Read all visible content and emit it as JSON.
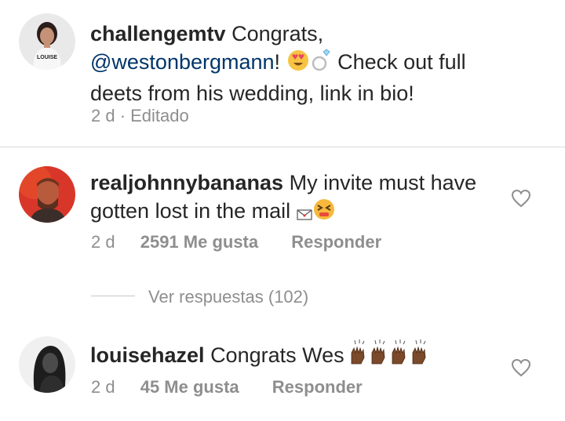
{
  "caption": {
    "username": "challengemtv",
    "text_1": "Congrats,",
    "mention": "@westonbergmann",
    "text_2": "!",
    "text_3": "Check out full",
    "text_4": "deets from his wedding, link in bio!",
    "meta": "2 d · Editado",
    "avatar_shirt_text": "LOUISE"
  },
  "comments": [
    {
      "username": "realjohnnybananas",
      "text_1": "My invite must have",
      "text_2": "gotten lost in the mail",
      "time": "2 d",
      "likes": "2591 Me gusta",
      "reply": "Responder"
    },
    {
      "username": "louisehazel",
      "text_1": "Congrats Wes",
      "time": "2 d",
      "likes": "45 Me gusta",
      "reply": "Responder"
    }
  ],
  "view_replies": "Ver respuestas (102)",
  "icons": [
    "heart-eyes-emoji",
    "ring-emoji",
    "envelope-emoji",
    "persevering-face-emoji",
    "raising-hands-emoji",
    "heart-icon"
  ],
  "colors": {
    "text": "#262626",
    "secondary": "#8e8e8e",
    "mention": "#003569",
    "divider": "#dbdbdb"
  }
}
